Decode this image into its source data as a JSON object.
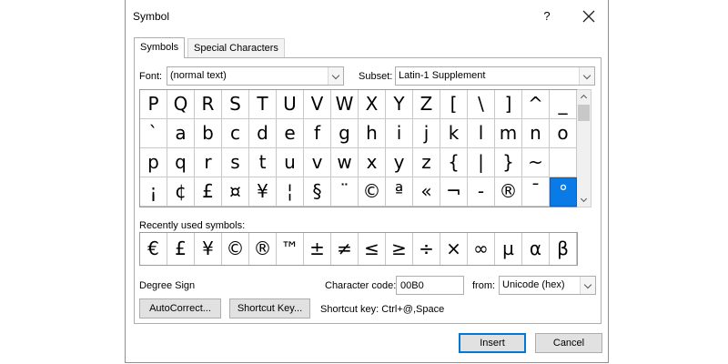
{
  "window": {
    "title": "Symbol",
    "help_label": "?",
    "close_label": "✕"
  },
  "tabs": [
    {
      "label": "Symbols",
      "active": true
    },
    {
      "label": "Special Characters",
      "active": false
    }
  ],
  "font": {
    "label": "Font:",
    "value": "(normal text)"
  },
  "subset": {
    "label": "Subset:",
    "value": "Latin-1 Supplement"
  },
  "symbol_grid": {
    "rows": [
      [
        "P",
        "Q",
        "R",
        "S",
        "T",
        "U",
        "V",
        "W",
        "X",
        "Y",
        "Z",
        "[",
        "\\",
        "]",
        "^",
        "_"
      ],
      [
        "`",
        "a",
        "b",
        "c",
        "d",
        "e",
        "f",
        "g",
        "h",
        "i",
        "j",
        "k",
        "l",
        "m",
        "n",
        "o"
      ],
      [
        "p",
        "q",
        "r",
        "s",
        "t",
        "u",
        "v",
        "w",
        "x",
        "y",
        "z",
        "{",
        "|",
        "}",
        "~",
        ""
      ],
      [
        "¡",
        "¢",
        "£",
        "¤",
        "¥",
        "¦",
        "§",
        "¨",
        "©",
        "ª",
        "«",
        "¬",
        "-",
        "®",
        "¯",
        "°"
      ]
    ],
    "selected": "°"
  },
  "recent": {
    "label": "Recently used symbols:",
    "symbols": [
      "€",
      "£",
      "¥",
      "©",
      "®",
      "™",
      "±",
      "≠",
      "≤",
      "≥",
      "÷",
      "×",
      "∞",
      "µ",
      "α",
      "β"
    ]
  },
  "character_name": "Degree Sign",
  "character_code": {
    "label": "Character code:",
    "value": "00B0"
  },
  "from": {
    "label": "from:",
    "value": "Unicode (hex)"
  },
  "buttons": {
    "autocorrect": "AutoCorrect...",
    "shortcut_key": "Shortcut Key...",
    "insert": "Insert",
    "cancel": "Cancel"
  },
  "shortcut_text": "Shortcut key: Ctrl+@,Space",
  "colors": {
    "selection": "#0a7ae6",
    "default_button_border": "#0078d7"
  }
}
